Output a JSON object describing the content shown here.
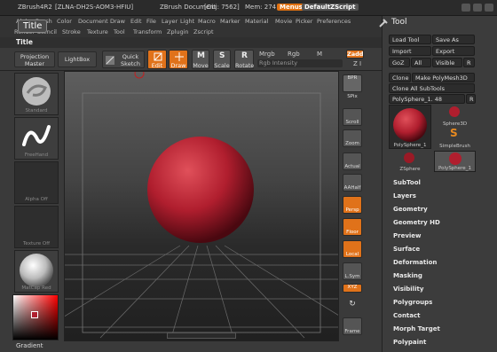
{
  "titlebar": {
    "app": "ZBrush4R2",
    "serial": "[ZLNA-DH2S-AOM3-HFIU]",
    "document": "ZBrush Document",
    "objinfo": "[Obj: 7562]",
    "mem": "Mem: 274",
    "menus_btn": "Menus",
    "script_btn": "DefaultZScript"
  },
  "menubar": {
    "row1": [
      "Alpha",
      "Brush",
      "Color",
      "Document",
      "Draw",
      "Edit",
      "File",
      "Layer",
      "Light",
      "Macro",
      "Marker",
      "Material",
      "Movie",
      "Picker",
      "Preferences"
    ],
    "row2": [
      "Render",
      "Stencil",
      "Stroke",
      "Texture",
      "Tool",
      "Transform",
      "Zplugin",
      "Zscript"
    ]
  },
  "tooltip": "Title",
  "titlerow": {
    "label": "Title"
  },
  "toolbar": {
    "projection_master": "Projection Master",
    "lightbox": "LightBox",
    "quick_sketch": "Quick Sketch",
    "edit": "Edit",
    "draw": "Draw",
    "move": "Move",
    "scale": "Scale",
    "rotate": "Rotate",
    "mrgb": "Mrgb",
    "rgb": "Rgb",
    "m": "M",
    "rgb_intensity": "Rgb Intensity",
    "zadd": "Zadd",
    "zi": "Z I"
  },
  "leftshelf": {
    "brush": "Standard",
    "stroke": "FreeHand",
    "alpha": "Alpha Off",
    "texture": "Texture Off",
    "material": "MatCap Red",
    "gradient": "Gradient"
  },
  "rightshelf": [
    "BPR",
    "SPix",
    "Scroll",
    "Zoom",
    "Actual",
    "AAHalf",
    "Persp",
    "Floor",
    "Local",
    "L.Sym",
    "XYZ",
    "Frame"
  ],
  "toolpanel": {
    "title": "Tool",
    "load": "Load Tool",
    "save": "Save As",
    "import": "Import",
    "export": "Export",
    "goz": "GoZ",
    "all": "All",
    "visible": "Visible",
    "r": "R",
    "clone": "Clone",
    "make_polymesh": "Make PolyMesh3D",
    "clone_all": "Clone All SubTools",
    "current_tool": "PolySphere_1. 48",
    "thumbs": [
      "PolySphere_1",
      "Sphere3D",
      "SimpleBrush",
      "ZSphere",
      "PolySphere_1"
    ],
    "subpalettes": [
      "SubTool",
      "Layers",
      "Geometry",
      "Geometry HD",
      "Preview",
      "Surface",
      "Deformation",
      "Masking",
      "Visibility",
      "Polygroups",
      "Contact",
      "Morph Target",
      "Polypaint"
    ]
  },
  "colors": {
    "accent": "#e07010",
    "sphere": "#b01e2e",
    "panel": "#3c3c3c"
  }
}
